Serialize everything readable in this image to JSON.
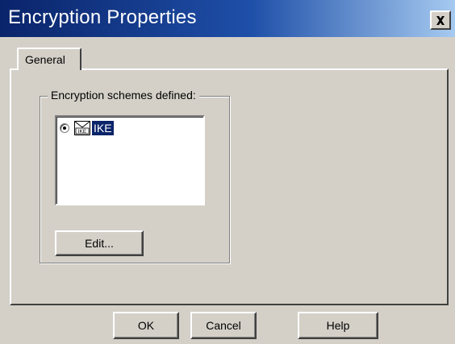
{
  "window": {
    "title": "Encryption Properties",
    "close_icon": "close-icon"
  },
  "tabs": [
    {
      "label": "General",
      "active": true
    }
  ],
  "group": {
    "label": "Encryption schemes defined:"
  },
  "schemes": [
    {
      "label": "IKE",
      "selected": true,
      "icon": "ike-icon"
    }
  ],
  "buttons": {
    "edit": "Edit...",
    "ok": "OK",
    "cancel": "Cancel",
    "help": "Help"
  },
  "colors": {
    "title_gradient_start": "#0a246a",
    "title_gradient_end": "#a6caf0",
    "selection": "#0a246a",
    "face": "#d4d0c8"
  }
}
